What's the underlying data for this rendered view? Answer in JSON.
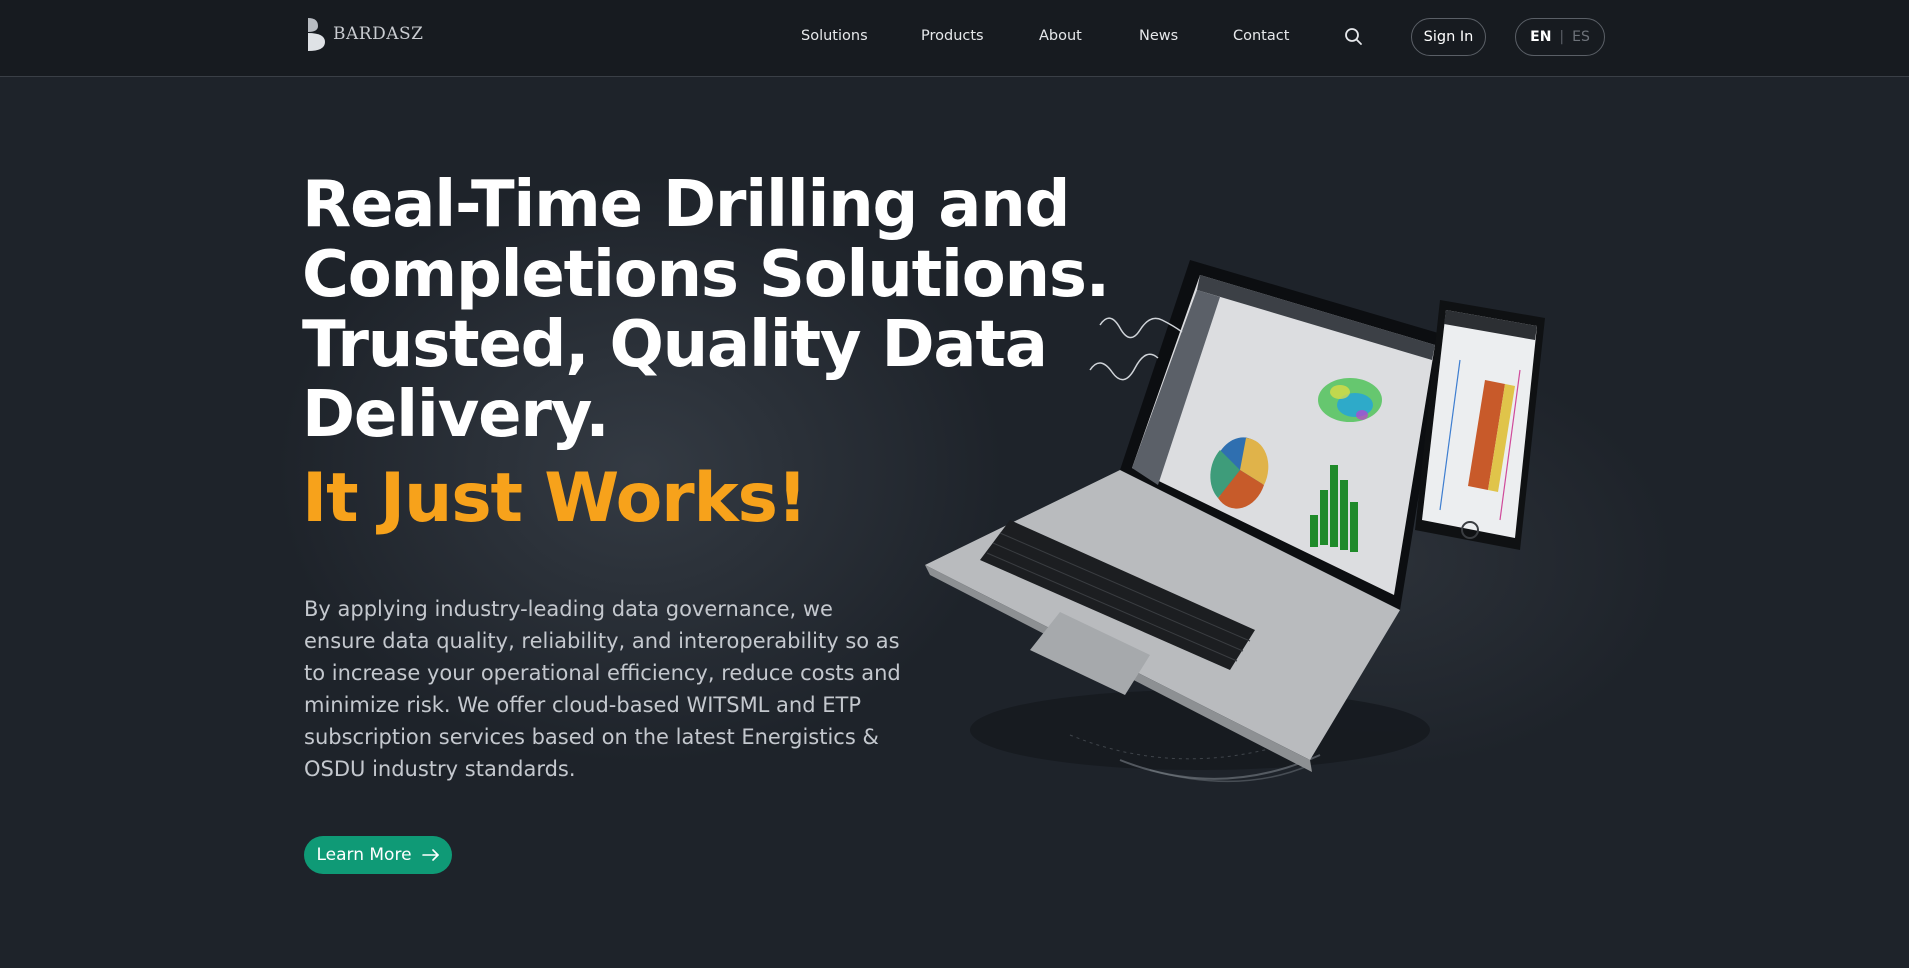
{
  "brand": {
    "name": "BARDASZ"
  },
  "nav": {
    "items": [
      {
        "label": "Solutions"
      },
      {
        "label": "Products"
      },
      {
        "label": "About"
      },
      {
        "label": "News"
      },
      {
        "label": "Contact"
      }
    ],
    "search_icon": "search-icon",
    "signin_label": "Sign In",
    "lang": {
      "active": "EN",
      "separator": "|",
      "inactive": "ES"
    }
  },
  "hero": {
    "headline_lines": [
      "Real-Time Drilling and",
      "Completions Solutions.",
      "Trusted, Quality Data",
      "Delivery."
    ],
    "tagline": "It Just Works!",
    "description": "By applying industry-leading data governance, we ensure data quality, reliability, and interoperability so as to increase your operational efficiency, reduce costs and minimize risk. We offer cloud-based WITSML and ETP subscription services based on the latest Energistics & OSDU industry standards.",
    "cta_label": "Learn More",
    "cta_icon": "arrow-right-icon"
  },
  "colors": {
    "background": "#1e232a",
    "header": "#171b20",
    "accent_orange": "#f7a21b",
    "cta_green": "#0f9a76"
  }
}
